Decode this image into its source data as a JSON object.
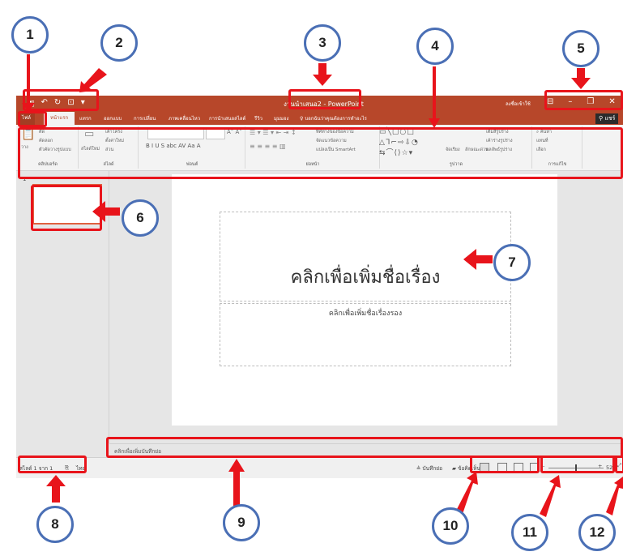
{
  "window": {
    "title": "งานนำเสนอ2 - PowerPoint",
    "signin": "ลงชื่อเข้าใช้",
    "share": "แชร์"
  },
  "qat": {
    "save": "🖫",
    "undo": "↶",
    "redo": "↻",
    "start": "⊡",
    "more": "▾"
  },
  "tabs": [
    {
      "label": "ไฟล์"
    },
    {
      "label": "หน้าแรก"
    },
    {
      "label": "แทรก"
    },
    {
      "label": "ออกแบบ"
    },
    {
      "label": "การเปลี่ยน"
    },
    {
      "label": "ภาพเคลื่อนไหว"
    },
    {
      "label": "การนำเสนอสไลด์"
    },
    {
      "label": "รีวิว"
    },
    {
      "label": "มุมมอง"
    }
  ],
  "tell_me": "บอกฉันว่าคุณต้องการทำอะไร",
  "ribbon": {
    "clipboard": {
      "label": "คลิปบอร์ด",
      "paste": "วาง",
      "cut": "ตัด",
      "copy": "คัดลอก",
      "format_painter": "ตัวคัดวางรูปแบบ"
    },
    "slides": {
      "label": "สไลด์",
      "new_slide": "สไลด์ใหม่",
      "layout": "เค้าโครง",
      "reset": "ตั้งค่าใหม่",
      "section": "ส่วน"
    },
    "font": {
      "label": "ฟอนต์",
      "row2": "B  I  U  S  abc  AV  Aa  A"
    },
    "paragraph": {
      "label": "ย่อหน้า",
      "text_direction": "ทิศทางของข้อความ",
      "align_text": "จัดแนวข้อความ",
      "smartart": "แปลงเป็น SmartArt"
    },
    "drawing": {
      "label": "รูปวาด",
      "arrange": "จัดเรียง",
      "quick_styles": "ลักษณะด่วน",
      "fill": "เติมสีรูปร่าง",
      "outline": "เค้าร่างรูปร่าง",
      "effects": "ผลลัพธ์รูปร่าง"
    },
    "editing": {
      "label": "การแก้ไข",
      "find": "ค้นหา",
      "replace": "แทนที่",
      "select": "เลือก"
    }
  },
  "slide_pane": {
    "number": "1"
  },
  "slide": {
    "title_placeholder": "คลิกเพื่อเพิ่มชื่อเรื่อง",
    "subtitle_placeholder": "คลิกเพื่อเพิ่มชื่อเรื่องรอง"
  },
  "notes": {
    "placeholder": "คลิกเพื่อเพิ่มบันทึกย่อ"
  },
  "status": {
    "slide_info": "สไลด์ 1 จาก 1",
    "language": "ไทย",
    "notes_btn": "บันทึกย่อ",
    "comments_btn": "ข้อคิดเห็น",
    "zoom": "52"
  },
  "annotations": [
    "1",
    "2",
    "3",
    "4",
    "5",
    "6",
    "7",
    "8",
    "9",
    "10",
    "11",
    "12"
  ]
}
